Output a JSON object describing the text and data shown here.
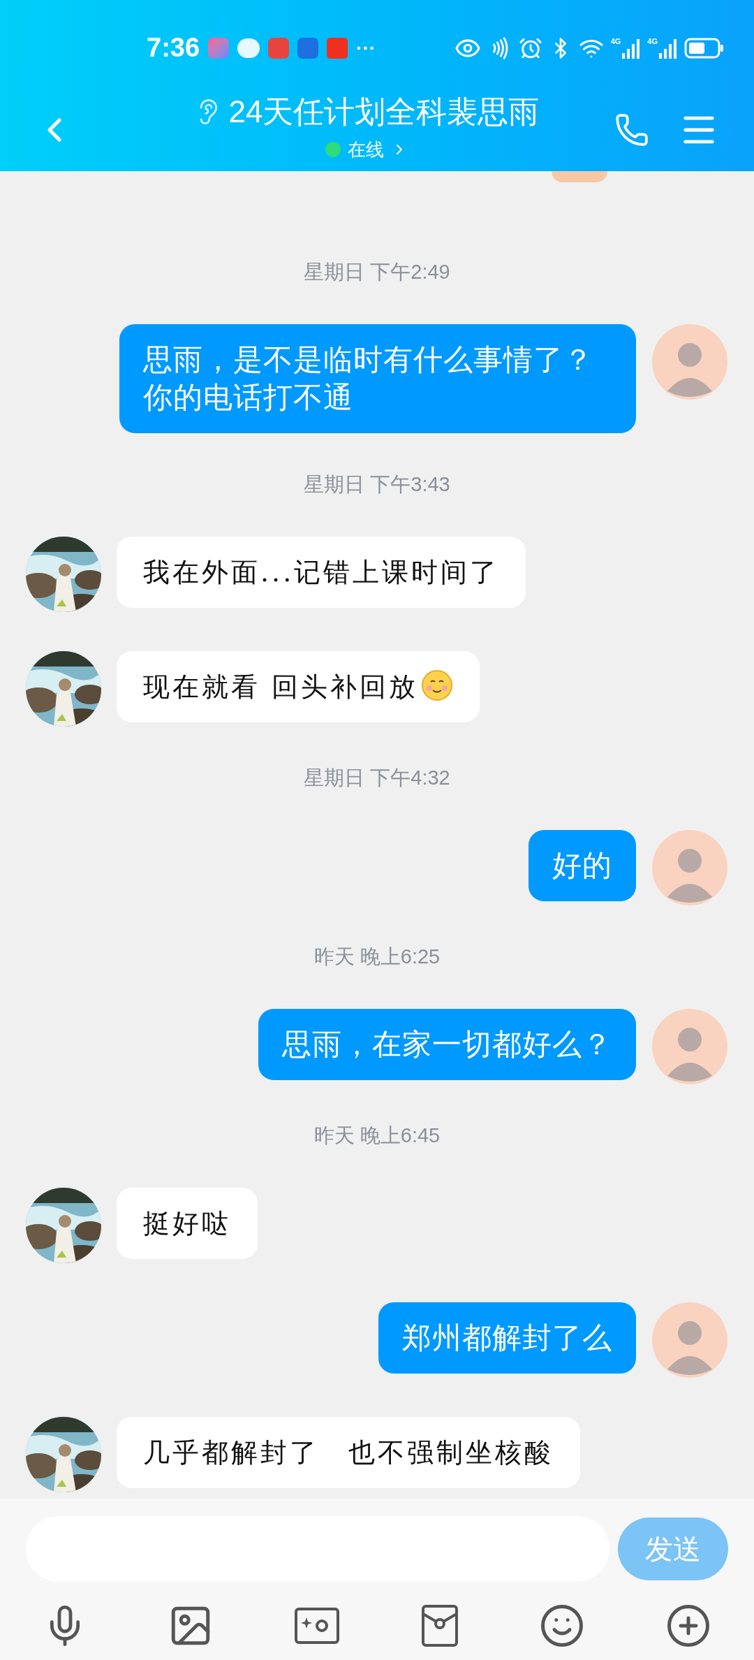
{
  "status_bar": {
    "time": "7:36",
    "more": "···",
    "signal_labels": [
      "4G",
      "4G"
    ]
  },
  "header": {
    "title": "24天任计划全科裴思雨",
    "presence": "在线",
    "online": true
  },
  "messages": [
    {
      "kind": "timestamp",
      "text": "星期日 下午2:49"
    },
    {
      "kind": "sent",
      "text": "思雨，是不是临时有什么事情了？你的电话打不通"
    },
    {
      "kind": "timestamp",
      "text": "星期日 下午3:43"
    },
    {
      "kind": "received",
      "text": "我在外面...记错上课时间了"
    },
    {
      "kind": "received",
      "text": "现在就看 回头补回放",
      "emoji": true
    },
    {
      "kind": "timestamp",
      "text": "星期日 下午4:32"
    },
    {
      "kind": "sent",
      "text": "好的"
    },
    {
      "kind": "timestamp",
      "text": "昨天 晚上6:25"
    },
    {
      "kind": "sent",
      "text": "思雨，在家一切都好么？"
    },
    {
      "kind": "timestamp",
      "text": "昨天 晚上6:45"
    },
    {
      "kind": "received",
      "text": "挺好哒"
    },
    {
      "kind": "sent",
      "text": "郑州都解封了么"
    },
    {
      "kind": "received",
      "text": "几乎都解封了　也不强制坐核酸"
    }
  ],
  "composer": {
    "send": "发送",
    "send_disabled": true
  }
}
